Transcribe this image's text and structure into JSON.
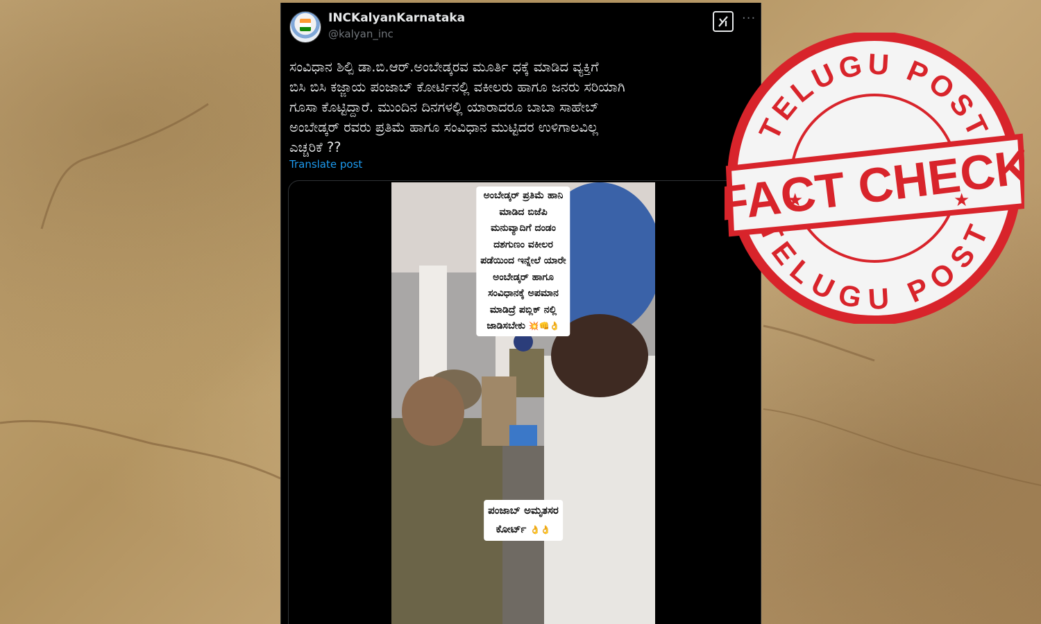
{
  "tweet": {
    "display_name": "INCKalyanKarnataka",
    "handle": "@kalyan_inc",
    "text": "ಸಂವಿಧಾನ ಶಿಲ್ಪಿ ಡಾ.ಬಿ.ಆರ್.ಅಂಬೇಡ್ಕರವ ಮೂರ್ತಿ ಧಕ್ಕೆ ಮಾಡಿದ ವ್ಯಕ್ತಿಗೆ\nಬಿಸಿ ಬಿಸಿ ಕಜ್ಜಾಯ ಪಂಜಾಬ್ ಕೋರ್ಟಿನಲ್ಲಿ ವಕೀಲರು ಹಾಗೂ ಜನರು ಸರಿಯಾಗಿ\nಗೂಸಾ ಕೊಟ್ಟಿದ್ದಾರೆ. ಮುಂದಿನ ದಿನಗಳಲ್ಲಿ ಯಾರಾದರೂ ಬಾಬಾ ಸಾಹೇಬ್\nಅಂಬೇಡ್ಕರ್ ರವರು ಪ್ರತಿಮೆ ಹಾಗೂ ಸಂವಿಧಾನ ಮುಟ್ಟಿದರ ಉಳಿಗಾಲವಿಲ್ಲ\nಎಚ್ಚರಿಕೆ ??",
    "translate_label": "Translate post",
    "grok_icon": "grok-icon",
    "more_icon": "more-options-icon"
  },
  "video": {
    "caption_top": "ಅಂಬೇಡ್ಕರ್ ಪ್ರತಿಮೆ ಹಾನಿ\nಮಾಡಿದ ಬಿಜೆಪಿ\nಮನುವ್ಯಾದಿಗೆ ದಂಡಂ\nದಶಗುಣಂ ವಕೀಲರ\nಪಡೆಯಿಂದ ಇನ್ನೇಲೆ ಯಾರೇ\nಅಂಬೇಡ್ಕರ್ ಹಾಗೂ\nಸಂವಿಧಾನಕ್ಕೆ ಅಪಮಾನ\nಮಾಡಿದ್ರೆ ಪಬ್ಲಿಕ್ ನಲ್ಲಿ\nಜಾಡಿಸಬೇಕು",
    "caption_top_emoji": "💥👊👌",
    "caption_bottom": "ಪಂಜಾಬ್ ಅಮೃತಸರ\nಕೋರ್ಟ್",
    "caption_bottom_emoji": "👌👌"
  },
  "stamp": {
    "top_text": "TELUGU POST",
    "center_text": "FACT CHECK",
    "bottom_text": "TELUGU POST",
    "color": "#d8242b"
  }
}
